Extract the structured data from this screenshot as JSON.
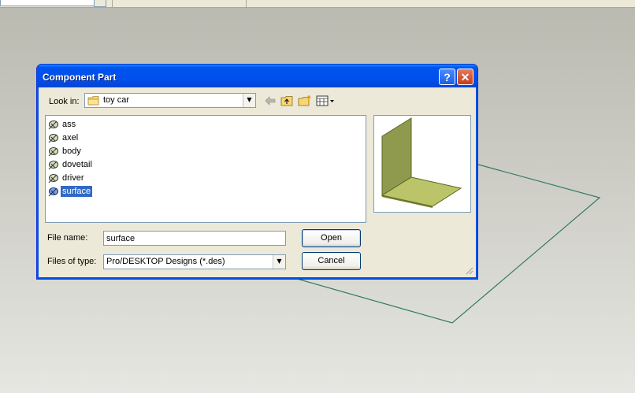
{
  "dialog": {
    "title": "Component Part",
    "help_label": "?",
    "close_label": "✕"
  },
  "look_in": {
    "label": "Look in:",
    "value": "toy car"
  },
  "files": [
    {
      "name": "ass",
      "selected": false
    },
    {
      "name": "axel",
      "selected": false
    },
    {
      "name": "body",
      "selected": false
    },
    {
      "name": "dovetail",
      "selected": false
    },
    {
      "name": "driver",
      "selected": false
    },
    {
      "name": "surface",
      "selected": true
    }
  ],
  "file_name": {
    "label": "File name:",
    "value": "surface"
  },
  "file_type": {
    "label": "Files of type:",
    "value": "Pro/DESKTOP Designs (*.des)"
  },
  "buttons": {
    "open": "Open",
    "cancel": "Cancel"
  },
  "icons": {
    "folder": "folder-icon",
    "back": "back-arrow-icon",
    "up": "up-folder-icon",
    "new_folder": "new-folder-icon",
    "view_menu": "view-menu-icon",
    "design_file": "design-file-icon"
  },
  "colors": {
    "titlebar": "#0050ee",
    "selection": "#316ac5",
    "preview_part": "#bcc46a",
    "sketch_line": "#2f7a60"
  }
}
